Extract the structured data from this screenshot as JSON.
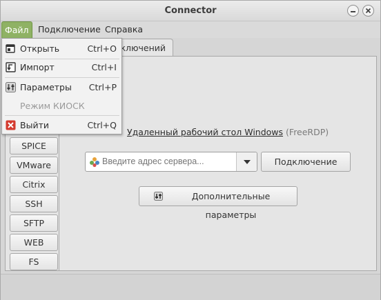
{
  "window": {
    "title": "Connector"
  },
  "menubar": {
    "items": [
      {
        "label": "Файл"
      },
      {
        "label": "Подключение"
      },
      {
        "label": "Справка"
      }
    ]
  },
  "file_menu": {
    "items": [
      {
        "label": "Открыть",
        "accel": "Ctrl+O",
        "icon": "open-icon"
      },
      {
        "label": "Импорт",
        "accel": "Ctrl+I",
        "icon": "import-icon"
      },
      {
        "label": "Параметры",
        "accel": "Ctrl+P",
        "icon": "settings-icon"
      },
      {
        "label": "Режим КИОСК",
        "accel": "",
        "icon": ""
      },
      {
        "label": "Выйти",
        "accel": "Ctrl+Q",
        "icon": "exit-icon"
      }
    ]
  },
  "tabs": [
    {
      "label": "ключений"
    }
  ],
  "sidebar": {
    "items": [
      "SPICE",
      "VMware",
      "Citrix",
      "SSH",
      "SFTP",
      "WEB",
      "FS"
    ]
  },
  "protocol": {
    "title": "Удаленный рабочий стол Windows",
    "subtitle": "(FreeRDP)"
  },
  "server_input": {
    "placeholder": "Введите адрес сервера..."
  },
  "buttons": {
    "connect": "Подключение",
    "advanced": "Дополнительные параметры"
  },
  "colors": {
    "menu_active": "#8fb264",
    "exit_icon": "#d43b2f"
  }
}
